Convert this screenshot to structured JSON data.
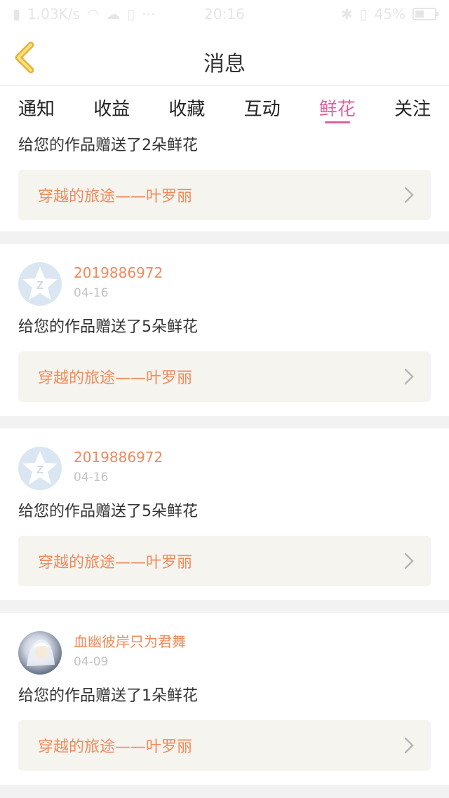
{
  "status_bar": {
    "left": "1.03K/s",
    "time": "20:16",
    "battery": "45%",
    "battery_fraction": 0.45
  },
  "nav": {
    "title": "消息",
    "back_icon": "chevron-left-icon"
  },
  "tabs": [
    {
      "label": "通知",
      "active": false
    },
    {
      "label": "收益",
      "active": false
    },
    {
      "label": "收藏",
      "active": false
    },
    {
      "label": "互动",
      "active": false
    },
    {
      "label": "鲜花",
      "active": true
    },
    {
      "label": "关注",
      "active": false
    }
  ],
  "colors": {
    "accent_pink": "#e05fa0",
    "accent_orange": "#f08a5b"
  },
  "feed": [
    {
      "gift_text": "给您的作品赠送了2朵鲜花",
      "work_title": "穿越的旅途——叶罗丽"
    },
    {
      "username": "2019886972",
      "date": "04-16",
      "avatar": "qq-default-avatar",
      "gift_text": "给您的作品赠送了5朵鲜花",
      "work_title": "穿越的旅途——叶罗丽"
    },
    {
      "username": "2019886972",
      "date": "04-16",
      "avatar": "qq-default-avatar",
      "gift_text": "给您的作品赠送了5朵鲜花",
      "work_title": "穿越的旅途——叶罗丽"
    },
    {
      "username": "血幽彼岸只为君舞",
      "date": "04-09",
      "avatar": "photo-avatar",
      "gift_text": "给您的作品赠送了1朵鲜花",
      "work_title": "穿越的旅途——叶罗丽"
    }
  ]
}
